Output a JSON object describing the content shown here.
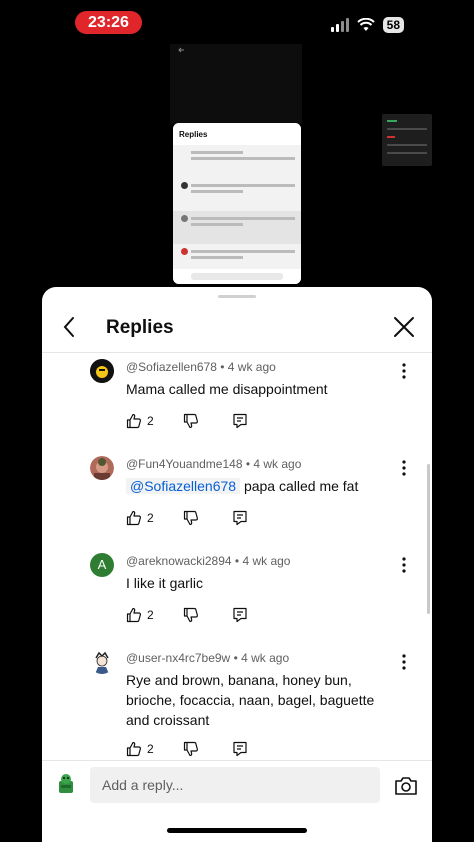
{
  "status_bar": {
    "time": "23:26",
    "battery": "58"
  },
  "sheet": {
    "title": "Replies",
    "reply_placeholder": "Add a reply...",
    "comments": [
      {
        "author": "@Sofiazellen678",
        "age": "4 wk ago",
        "text": "Mama called me disappointment",
        "likes": "2"
      },
      {
        "author": "@Fun4Youandme148",
        "age": "4 wk ago",
        "mention": "@Sofiazellen678",
        "text": "papa called me fat",
        "likes": "2"
      },
      {
        "author": "@areknowacki2894",
        "age": "4 wk ago",
        "text": "I like it garlic",
        "likes": "2",
        "avatar_letter": "A"
      },
      {
        "author": "@user-nx4rc7be9w",
        "age": "4 wk ago",
        "text": "Rye and brown, banana, honey bun, brioche, focaccia, naan, bagel, baguette and croissant",
        "likes": "2"
      }
    ]
  },
  "colors": {
    "accent_red": "#e0262b",
    "mention_blue": "#065fd4",
    "avatar_green": "#2e7d32"
  },
  "icons": [
    "back-arrow-icon",
    "close-icon",
    "kebab-menu-icon",
    "thumbs-up-icon",
    "thumbs-down-icon",
    "reply-icon",
    "camera-icon"
  ]
}
